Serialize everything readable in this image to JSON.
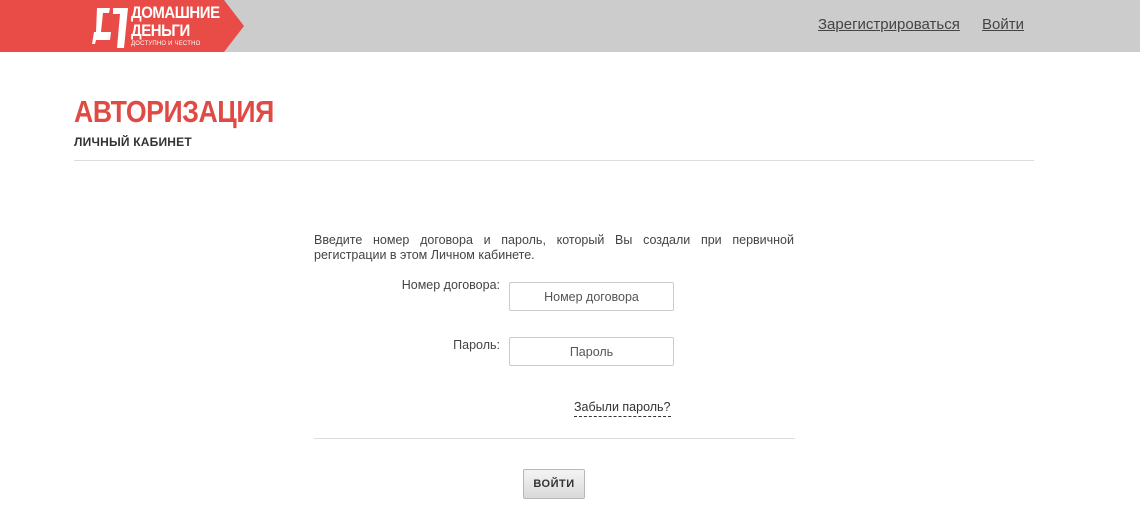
{
  "header": {
    "logo": {
      "line1": "ДОМАШНИЕ",
      "line2": "ДЕНЬГИ",
      "tagline": "доступно и честно",
      "brand_color": "#e94b47"
    },
    "nav": {
      "register": "Зарегистрироваться",
      "login": "Войти"
    },
    "background_color": "#cccccc"
  },
  "page": {
    "title": "АВТОРИЗАЦИЯ",
    "subtitle": "ЛИЧНЫЙ КАБИНЕТ",
    "title_color": "#e04a45"
  },
  "form": {
    "intro": "Введите номер договора и пароль, который Вы создали при первичной регистрации в этом Личном кабинете.",
    "contract_label": "Номер договора:",
    "contract_placeholder": "Номер договора",
    "contract_value": "",
    "password_label": "Пароль:",
    "password_placeholder": "Пароль",
    "password_value": "",
    "forgot_link": "Забыли пароль?",
    "submit_label": "ВОЙТИ"
  }
}
